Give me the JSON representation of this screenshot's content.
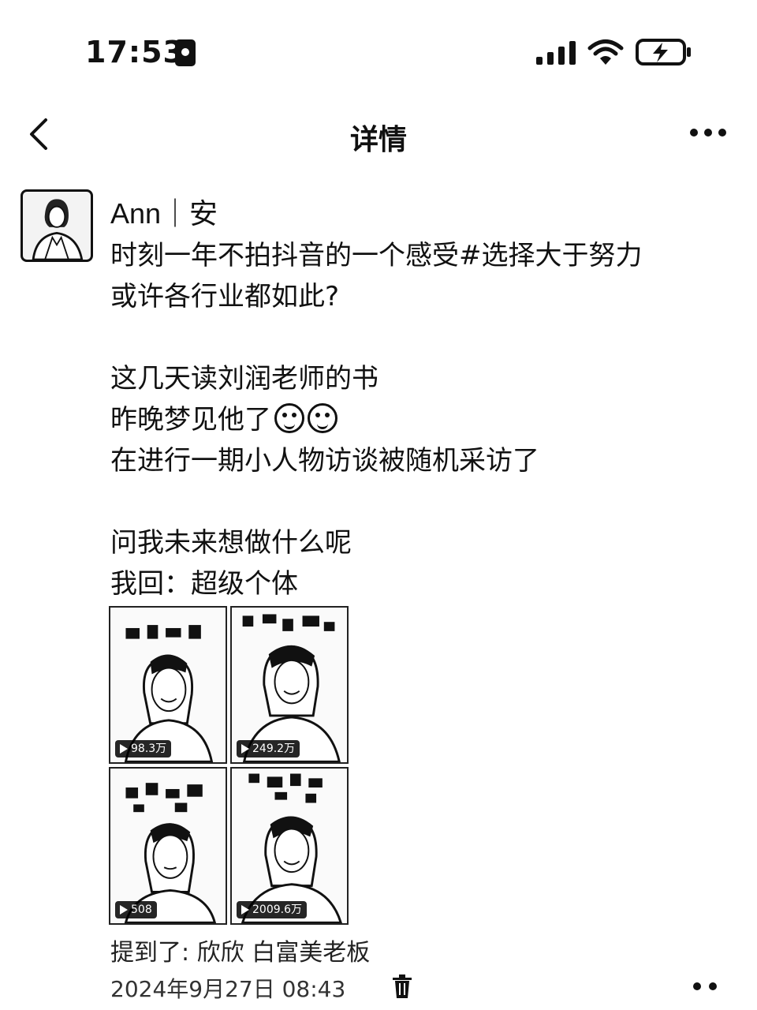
{
  "status_bar": {
    "time": "17:53",
    "icons": [
      "sim-card-icon",
      "signal-icon",
      "wifi-icon",
      "battery-charging-icon"
    ]
  },
  "nav": {
    "title": "详情",
    "back_icon": "chevron-left-icon",
    "more_icon": "more-horizontal-icon"
  },
  "post": {
    "author": "Ann｜安",
    "lines": [
      "时刻一年不拍抖音的一个感受#选择大于努力",
      "或许各行业都如此?",
      "",
      "这几天读刘润老师的书",
      "昨晚梦见他了",
      "在进行一期小人物访谈被随机采访了",
      "",
      "问我未来想做什么呢",
      "我回：超级个体"
    ],
    "emoji_count": 2,
    "media": [
      {
        "badge": "98.3万"
      },
      {
        "badge": "249.2万"
      },
      {
        "badge": "508"
      },
      {
        "badge": "2009.6万"
      }
    ],
    "mention_label": "提到了:",
    "mentions": [
      "欣欣",
      "白富美老板"
    ],
    "timestamp": "2024年9月27日 08:43"
  }
}
